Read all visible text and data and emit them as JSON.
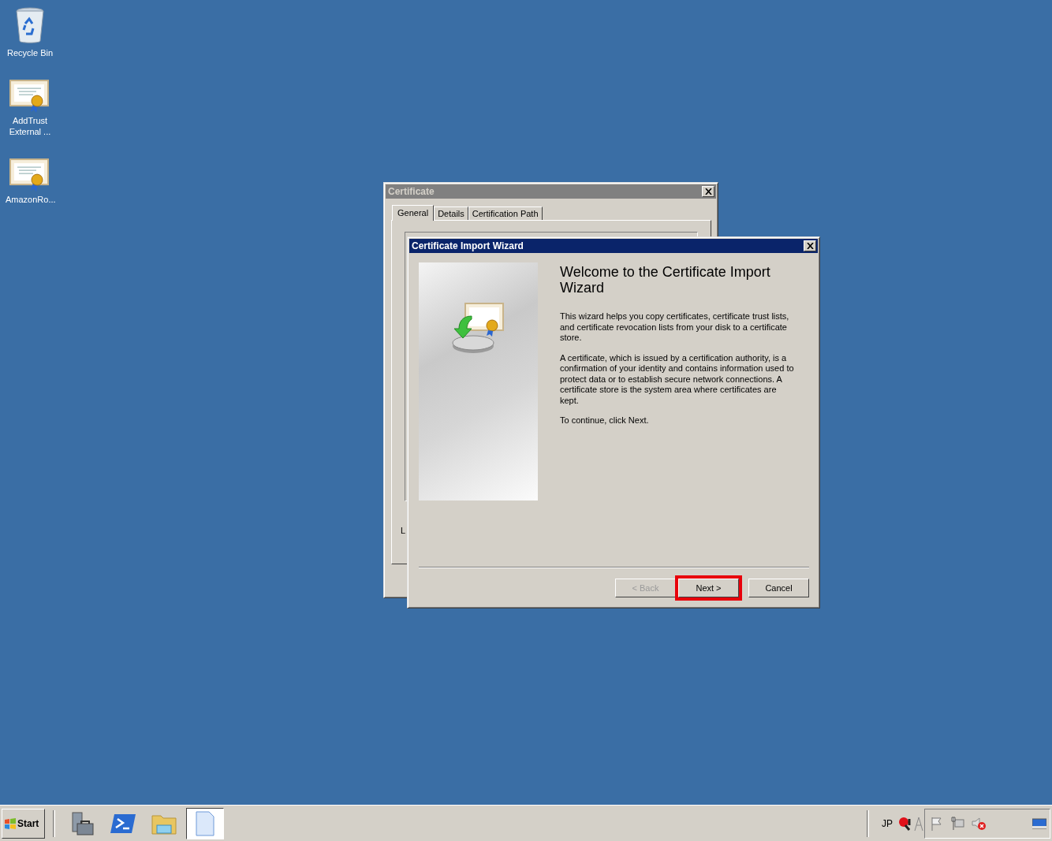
{
  "desktop_icons": [
    {
      "kind": "recycle",
      "label": "Recycle Bin"
    },
    {
      "kind": "certificate",
      "label": "AddTrust External ..."
    },
    {
      "kind": "certificate",
      "label": "AmazonRo..."
    }
  ],
  "certificate_window": {
    "title": "Certificate",
    "tabs": [
      {
        "label": "General",
        "selected": true
      },
      {
        "label": "Details",
        "selected": false
      },
      {
        "label": "Certification Path",
        "selected": false
      }
    ],
    "partial_label": "L"
  },
  "wizard": {
    "title": "Certificate Import Wizard",
    "heading": "Welcome to the Certificate Import Wizard",
    "paragraphs": [
      "This wizard helps you copy certificates, certificate trust lists, and certificate revocation lists from your disk to a certificate store.",
      "A certificate, which is issued by a certification authority, is a confirmation of your identity and contains information used to protect data or to establish secure network connections. A certificate store is the system area where certificates are kept.",
      "To continue, click Next."
    ],
    "buttons": [
      {
        "label": "< Back",
        "disabled": true,
        "highlighted": false
      },
      {
        "label": "Next >",
        "disabled": false,
        "highlighted": true
      },
      {
        "label": "Cancel",
        "disabled": false,
        "highlighted": false
      }
    ]
  },
  "taskbar": {
    "start_label": "Start",
    "apps": [
      {
        "kind": "server",
        "pressed": false
      },
      {
        "kind": "terminal",
        "pressed": false
      },
      {
        "kind": "folder",
        "pressed": false
      },
      {
        "kind": "document",
        "pressed": true
      }
    ],
    "language": "JP"
  }
}
